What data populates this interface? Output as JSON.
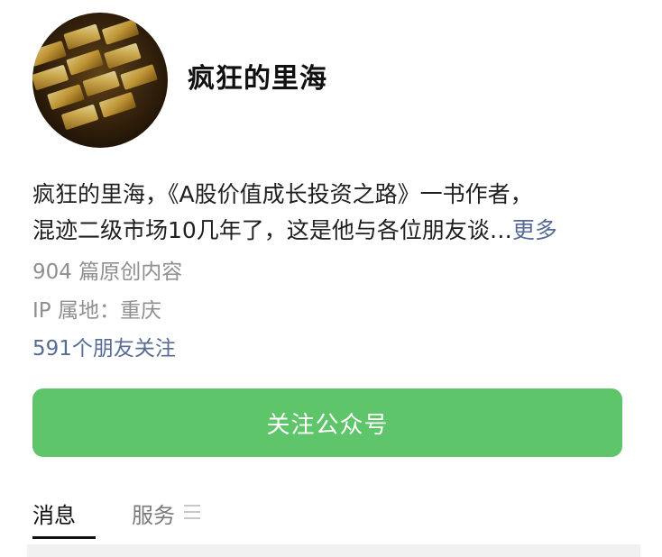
{
  "profile": {
    "avatar_icon": "gold-bars-avatar",
    "name": "疯狂的里海"
  },
  "bio": {
    "line1": "疯狂的里海，《A股价值成长投资之路》一书作者，",
    "line2": "混迹二级市场10几年了，这是他与各位朋友谈…",
    "more_label": "更多"
  },
  "stats": {
    "articles": "904 篇原创内容",
    "ip_location": "IP 属地：重庆",
    "followers": "591个朋友关注"
  },
  "follow_button": {
    "label": "关注公众号",
    "color": "#5ec56a"
  },
  "tabs": [
    {
      "label": "消息",
      "active": true
    },
    {
      "label": "服务",
      "active": false,
      "icon": "menu-icon"
    }
  ],
  "colors": {
    "link": "#576b95",
    "muted": "#8f8f8f"
  }
}
